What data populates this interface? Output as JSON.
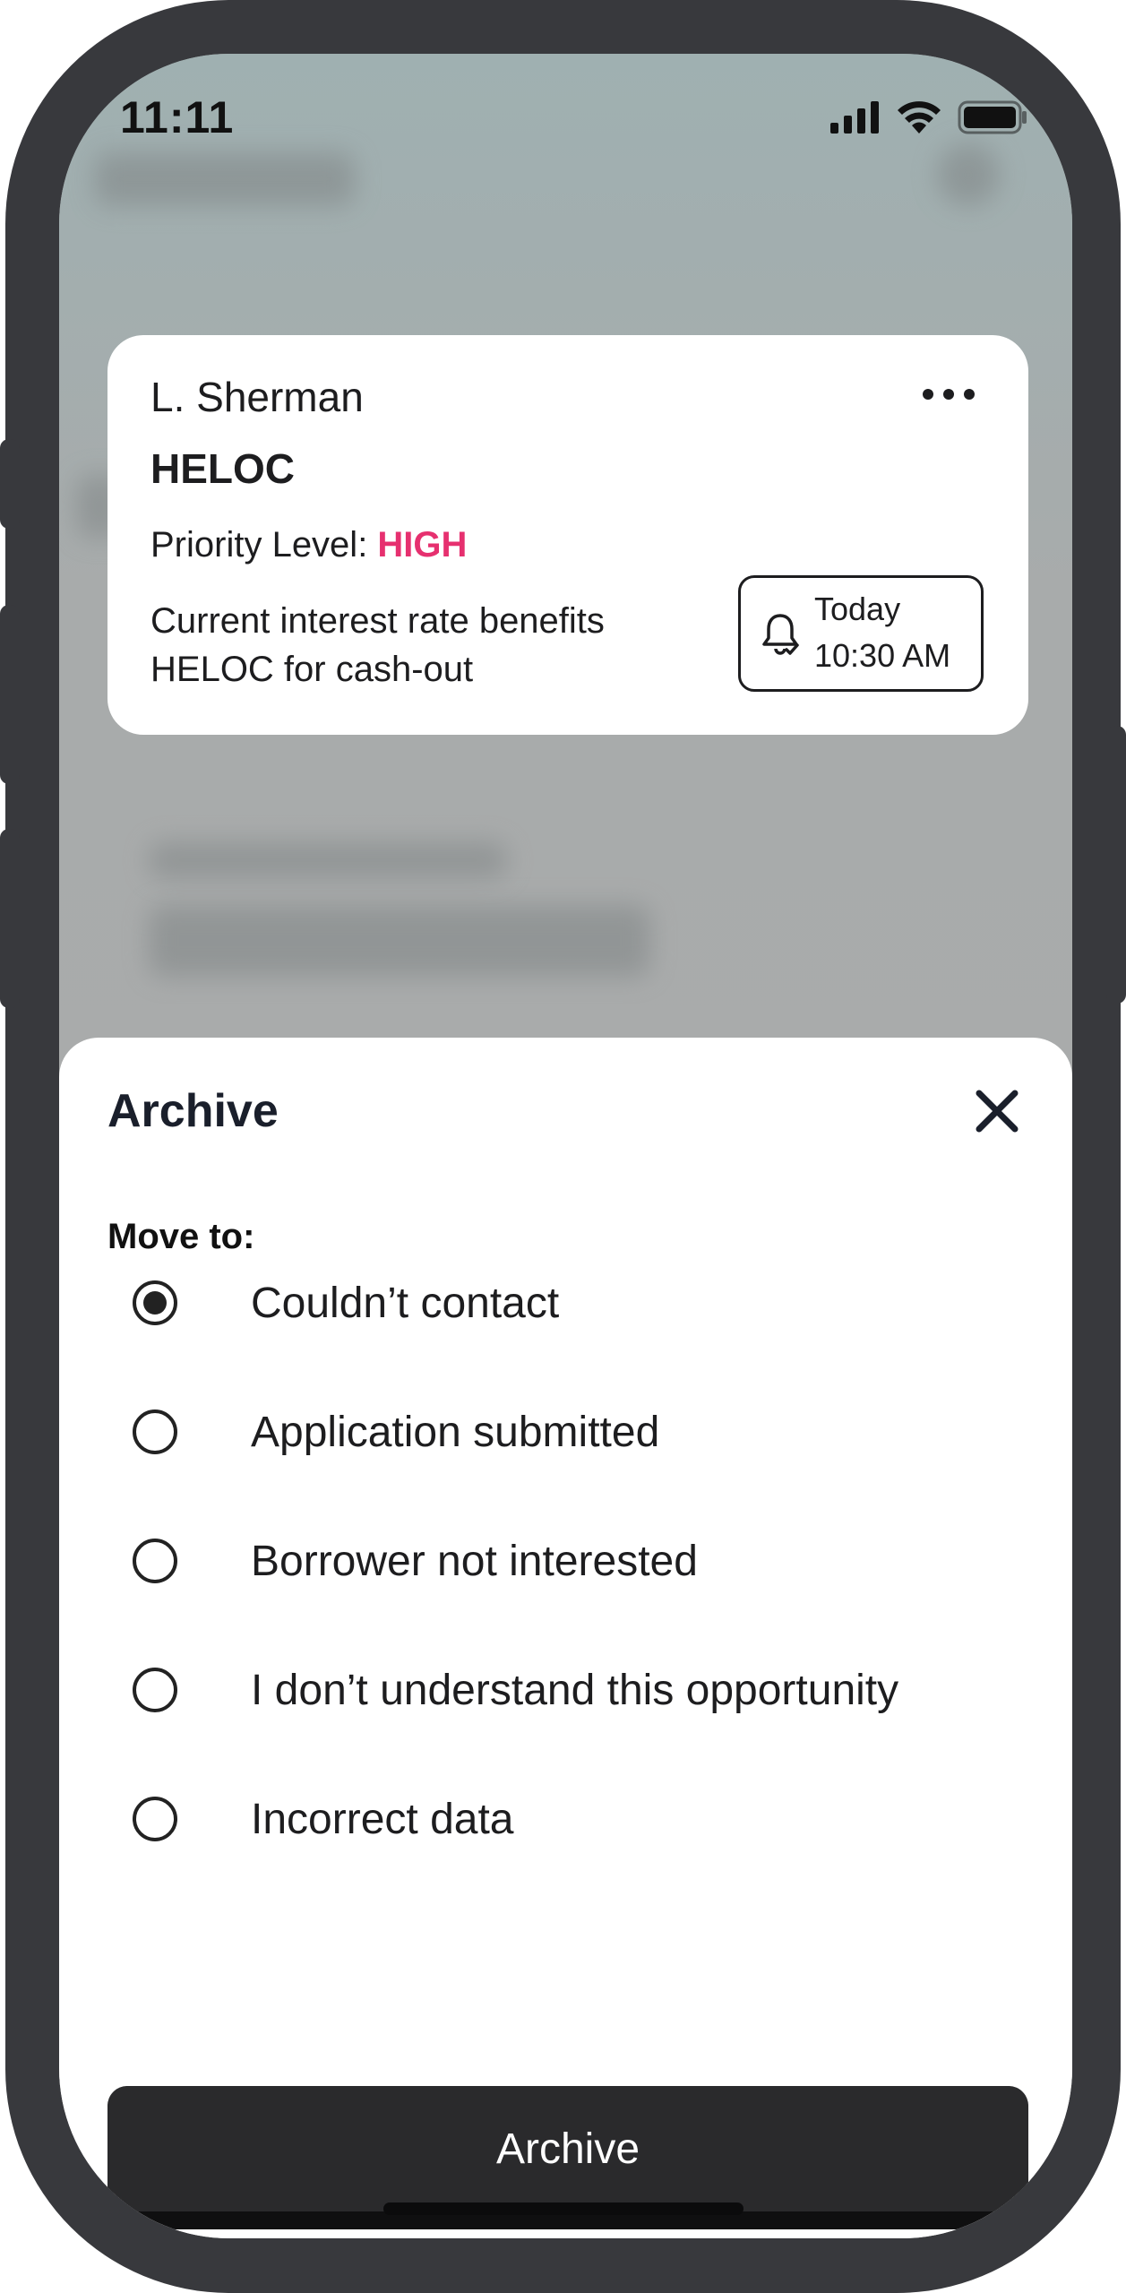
{
  "status_bar": {
    "time": "11:11",
    "icons": [
      "cellular-signal-icon",
      "wifi-icon",
      "battery-icon"
    ]
  },
  "card": {
    "name": "L. Sherman",
    "product": "HELOC",
    "priority_label": "Priority Level: ",
    "priority_value": "HIGH",
    "description": "Current interest rate benefits HELOC for cash-out",
    "reminder": {
      "day": "Today",
      "time": "10:30 AM"
    },
    "more_icon": "more-horizontal-icon"
  },
  "sheet": {
    "title": "Archive",
    "close_icon": "close-icon",
    "move_to_label": "Move to:",
    "options": [
      {
        "label": "Couldn’t contact",
        "selected": true
      },
      {
        "label": "Application submitted",
        "selected": false
      },
      {
        "label": "Borrower not interested",
        "selected": false
      },
      {
        "label": "I don’t understand this opportunity",
        "selected": false
      },
      {
        "label": "Incorrect data",
        "selected": false
      }
    ],
    "archive_button": "Archive"
  },
  "colors": {
    "priority_high": "#e6306f",
    "button_bg": "#2a2a2c",
    "frame": "#38393d"
  }
}
